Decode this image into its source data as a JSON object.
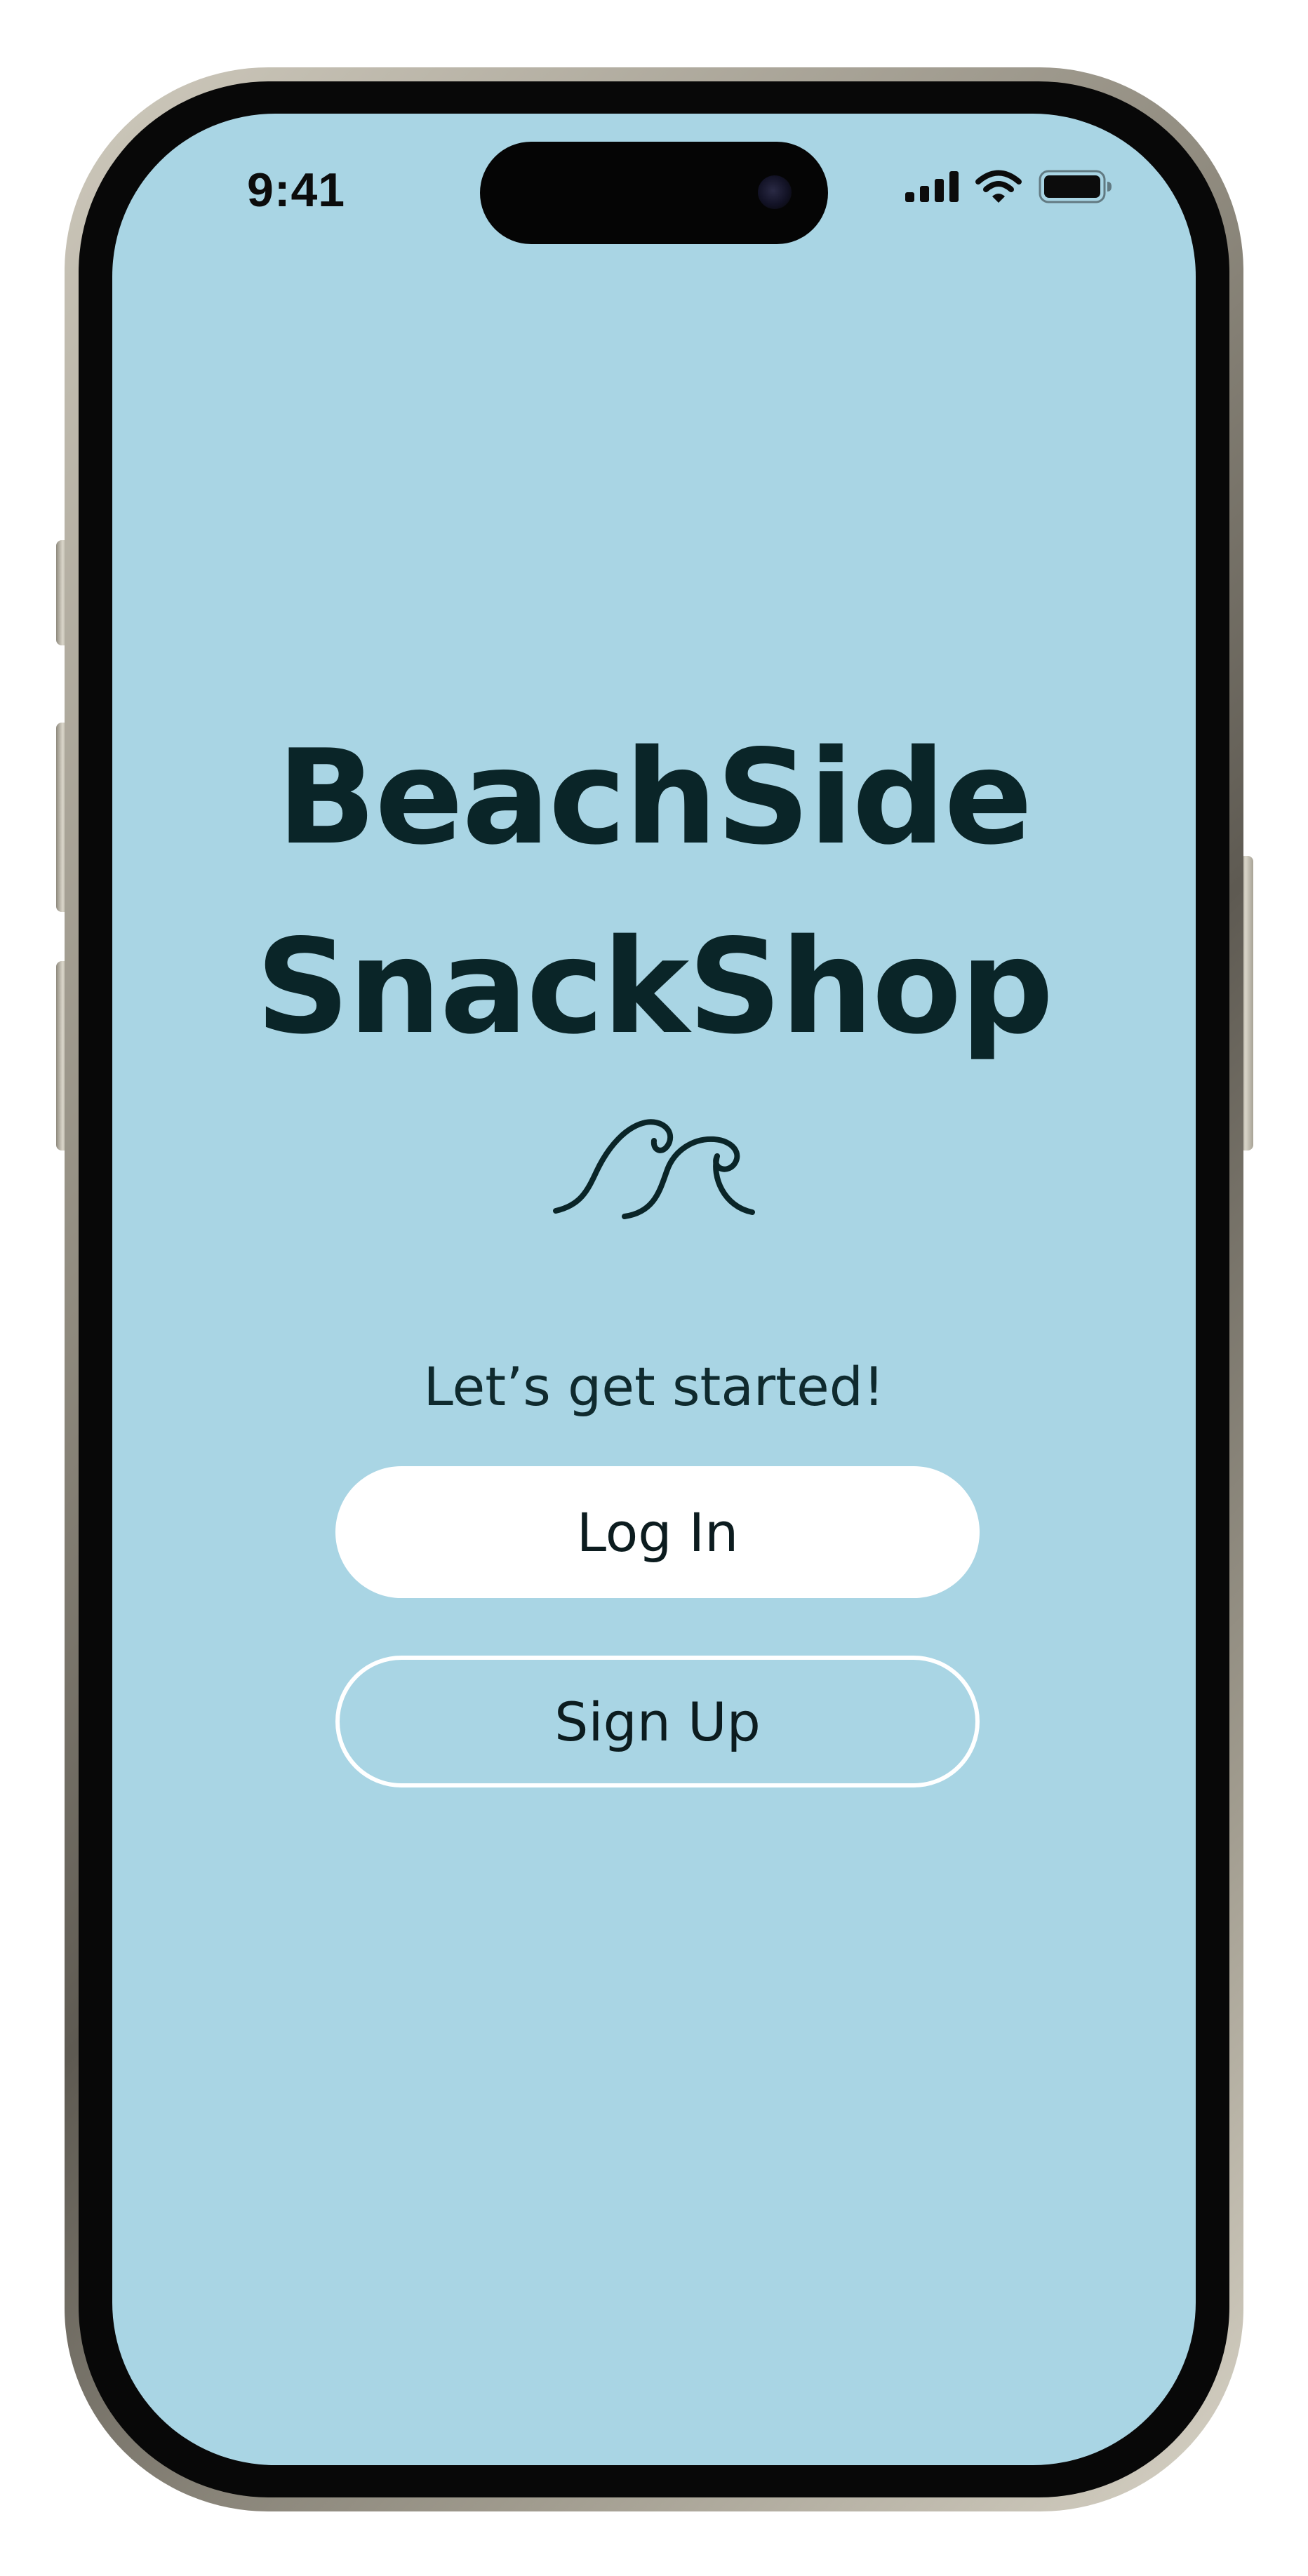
{
  "status_bar": {
    "time": "9:41",
    "icons": [
      "signal-icon",
      "wifi-icon",
      "battery-icon"
    ]
  },
  "app": {
    "title_line1": "BeachSide",
    "title_line2": "SnackShop",
    "logo_icon": "wave-icon",
    "tagline": "Let’s get started!"
  },
  "actions": {
    "login_label": "Log In",
    "signup_label": "Sign Up"
  },
  "colors": {
    "background": "#a9d5e4",
    "title": "#0a2528",
    "button_fill": "#ffffff",
    "button_outline": "#ffffff"
  }
}
